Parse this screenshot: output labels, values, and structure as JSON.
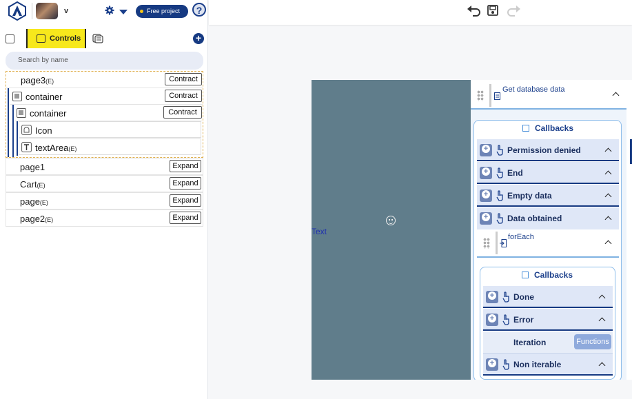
{
  "header": {
    "username": "v",
    "plan_badge": "Free project",
    "help_label": "?"
  },
  "panel_tabs": {
    "controls_label": "Controls"
  },
  "search": {
    "placeholder": "Search by name"
  },
  "tree": [
    {
      "label": "page3",
      "suffix": "(E)",
      "button": "Contract"
    },
    {
      "label": "container",
      "suffix": "",
      "button": "Contract"
    },
    {
      "label": "container",
      "suffix": "",
      "button": "Contract"
    },
    {
      "label": "Icon",
      "suffix": "",
      "button": ""
    },
    {
      "label": "textArea",
      "suffix": "(E)",
      "button": ""
    }
  ],
  "pages": [
    {
      "label": "page1",
      "suffix": "",
      "button": "Expand"
    },
    {
      "label": "Cart",
      "suffix": "(E)",
      "button": "Expand"
    },
    {
      "label": "page",
      "suffix": "(E)",
      "button": "Expand"
    },
    {
      "label": "page2",
      "suffix": "(E)",
      "button": "Expand"
    }
  ],
  "canvas": {
    "text_label": "Text"
  },
  "logic": {
    "action_title": "Get database data",
    "callbacks_title": "Callbacks",
    "events": [
      "Permission denied",
      "End",
      "Empty data",
      "Data obtained"
    ],
    "foreach_title": "forEach",
    "inner_callbacks_title": "Callbacks",
    "inner_events": [
      "Done",
      "Error"
    ],
    "iteration_label": "Iteration",
    "functions_button": "Functions",
    "last_event": "Non iterable"
  },
  "colors": {
    "brand": "#163a82",
    "highlight": "#f7e81c",
    "canvas_bg": "#607d8b"
  }
}
